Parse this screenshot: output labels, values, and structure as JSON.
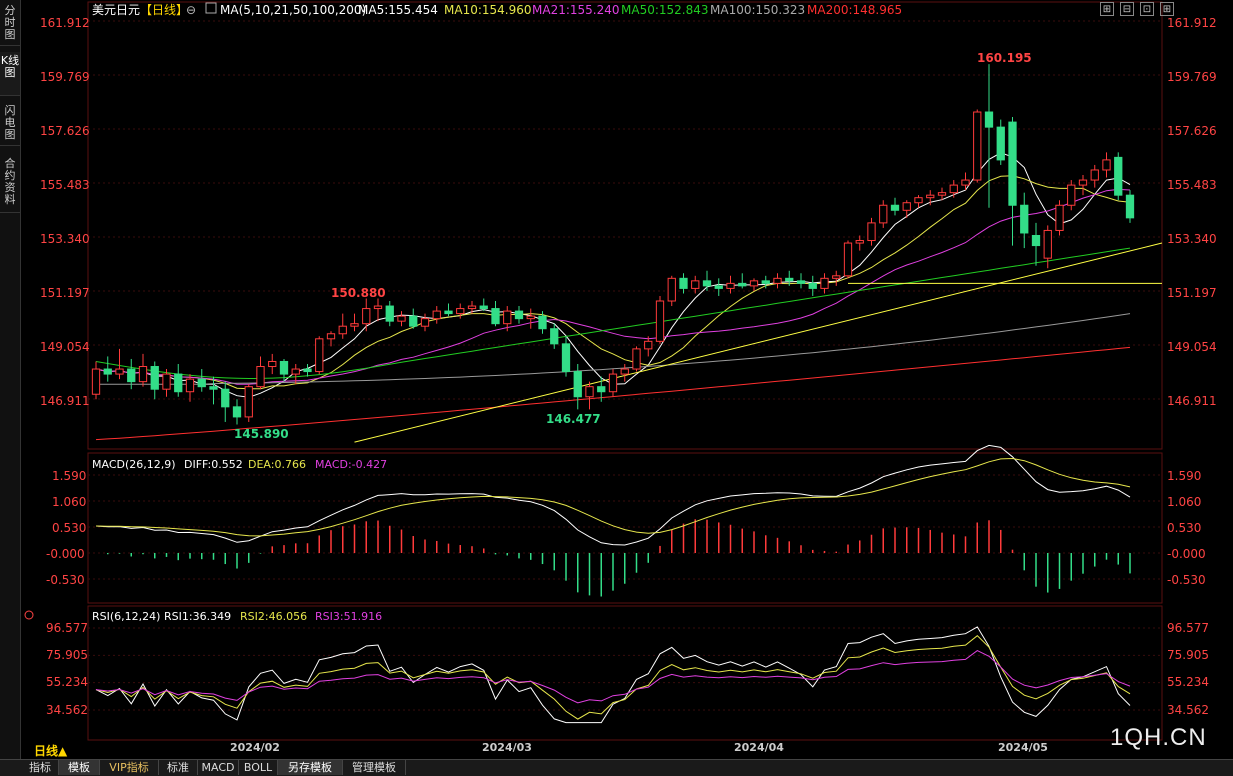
{
  "sidebar": {
    "tabs": [
      {
        "label": "分时图",
        "active": false
      },
      {
        "label": "K线图",
        "active": true
      },
      {
        "label": "闪电图",
        "active": false
      },
      {
        "label": "合约资料",
        "active": false
      }
    ]
  },
  "header": {
    "symbol": "美元日元",
    "period_tag": "【日线】",
    "ma_title": "MA(5,10,21,50,100,200)",
    "ma5": "MA5:155.454",
    "ma10": "MA10:154.960",
    "ma21": "MA21:155.240",
    "ma50": "MA50:152.843",
    "ma100": "MA100:150.323",
    "ma200": "MA200:148.965"
  },
  "price_axis": [
    "161.912",
    "159.769",
    "157.626",
    "155.483",
    "153.340",
    "151.197",
    "149.054",
    "146.911"
  ],
  "annotations": {
    "high": "160.195",
    "low1": "145.890",
    "low2": "146.477",
    "mid_high": "150.880"
  },
  "macd": {
    "title": "MACD(26,12,9)",
    "diff": "DIFF:0.552",
    "dea": "DEA:0.766",
    "macd": "MACD:-0.427",
    "axis": [
      "1.590",
      "1.060",
      "0.530",
      "-0.000",
      "-0.530"
    ]
  },
  "rsi": {
    "title": "RSI(6,12,24)",
    "rsi1": "RSI1:36.349",
    "rsi2": "RSI2:46.056",
    "rsi3": "RSI3:51.916",
    "axis": [
      "96.577",
      "75.905",
      "55.234",
      "34.562"
    ]
  },
  "date_axis": [
    "2024/02",
    "2024/03",
    "2024/04",
    "2024/05"
  ],
  "bottom_tabs": [
    {
      "label": "指标",
      "active": false
    },
    {
      "label": "模板",
      "active": true
    },
    {
      "label": "VIP指标",
      "active": false
    },
    {
      "label": "标准",
      "active": false
    },
    {
      "label": "MACD",
      "active": false
    },
    {
      "label": "BOLL",
      "active": false
    },
    {
      "label": "另存模板",
      "active": true
    },
    {
      "label": "管理模板",
      "active": false
    }
  ],
  "period_label": "日线▲",
  "watermark": "1QH.CN",
  "colors": {
    "up": "#ff3b3b",
    "down": "#33dd88",
    "ma5": "#ffffff",
    "ma10": "#e6e64c",
    "ma21": "#e040e0",
    "ma50": "#22cc22",
    "ma100": "#999999",
    "ma200": "#ff3030",
    "trend": "#ffff44",
    "axis_text": "#ff4444"
  },
  "chart_data": {
    "type": "candlestick",
    "title": "美元日元【日线】",
    "x_labels": [
      "2024/02",
      "2024/03",
      "2024/04",
      "2024/05"
    ],
    "ylim": [
      145.5,
      162.3
    ],
    "y_ticks": [
      161.912,
      159.769,
      157.626,
      155.483,
      153.34,
      151.197,
      149.054,
      146.911
    ],
    "ohlc": [
      [
        147.1,
        148.4,
        146.9,
        148.1
      ],
      [
        148.1,
        148.6,
        147.6,
        147.9
      ],
      [
        147.9,
        148.9,
        147.7,
        148.1
      ],
      [
        148.1,
        148.5,
        147.3,
        147.6
      ],
      [
        147.6,
        148.7,
        147.4,
        148.2
      ],
      [
        148.2,
        148.4,
        146.9,
        147.3
      ],
      [
        147.3,
        148.1,
        147.0,
        147.9
      ],
      [
        147.9,
        148.3,
        147.0,
        147.2
      ],
      [
        147.2,
        147.9,
        146.8,
        147.7
      ],
      [
        147.7,
        148.1,
        147.2,
        147.4
      ],
      [
        147.4,
        147.8,
        146.7,
        147.3
      ],
      [
        147.3,
        147.6,
        146.0,
        146.6
      ],
      [
        146.6,
        146.9,
        145.9,
        146.2
      ],
      [
        146.2,
        147.5,
        146.0,
        147.4
      ],
      [
        147.4,
        148.6,
        147.3,
        148.2
      ],
      [
        148.2,
        148.7,
        147.9,
        148.4
      ],
      [
        148.4,
        148.5,
        147.6,
        147.9
      ],
      [
        147.9,
        148.3,
        147.5,
        148.1
      ],
      [
        148.1,
        148.3,
        147.8,
        148.0
      ],
      [
        148.0,
        149.4,
        147.9,
        149.3
      ],
      [
        149.3,
        149.6,
        149.0,
        149.5
      ],
      [
        149.5,
        150.3,
        149.3,
        149.8
      ],
      [
        149.8,
        150.3,
        149.6,
        149.9
      ],
      [
        149.9,
        150.9,
        149.6,
        150.5
      ],
      [
        150.5,
        150.9,
        150.0,
        150.6
      ],
      [
        150.6,
        150.8,
        149.8,
        150.0
      ],
      [
        150.0,
        150.4,
        149.8,
        150.2
      ],
      [
        150.2,
        150.5,
        149.7,
        149.8
      ],
      [
        149.8,
        150.3,
        149.6,
        150.1
      ],
      [
        150.1,
        150.6,
        149.9,
        150.4
      ],
      [
        150.4,
        150.7,
        150.2,
        150.3
      ],
      [
        150.3,
        150.7,
        150.1,
        150.5
      ],
      [
        150.5,
        150.8,
        150.3,
        150.6
      ],
      [
        150.6,
        150.9,
        150.4,
        150.5
      ],
      [
        150.5,
        150.8,
        149.8,
        149.9
      ],
      [
        149.9,
        150.6,
        149.6,
        150.4
      ],
      [
        150.4,
        150.6,
        149.9,
        150.1
      ],
      [
        150.1,
        150.5,
        149.7,
        150.2
      ],
      [
        150.2,
        150.4,
        149.5,
        149.7
      ],
      [
        149.7,
        149.9,
        148.9,
        149.1
      ],
      [
        149.1,
        149.4,
        147.8,
        148.0
      ],
      [
        148.0,
        148.3,
        146.5,
        147.0
      ],
      [
        147.0,
        147.6,
        146.5,
        147.4
      ],
      [
        147.4,
        147.8,
        146.8,
        147.2
      ],
      [
        147.2,
        148.1,
        147.0,
        147.9
      ],
      [
        147.9,
        148.3,
        147.6,
        148.1
      ],
      [
        148.1,
        149.0,
        148.0,
        148.9
      ],
      [
        148.9,
        149.4,
        148.6,
        149.2
      ],
      [
        149.2,
        151.0,
        149.1,
        150.8
      ],
      [
        150.8,
        151.8,
        150.6,
        151.7
      ],
      [
        151.7,
        151.9,
        151.1,
        151.3
      ],
      [
        151.3,
        151.8,
        151.1,
        151.6
      ],
      [
        151.6,
        152.0,
        151.2,
        151.4
      ],
      [
        151.4,
        151.7,
        151.0,
        151.3
      ],
      [
        151.3,
        151.8,
        151.1,
        151.5
      ],
      [
        151.5,
        151.9,
        151.3,
        151.4
      ],
      [
        151.4,
        151.7,
        151.2,
        151.6
      ],
      [
        151.6,
        151.8,
        151.3,
        151.5
      ],
      [
        151.5,
        151.9,
        151.3,
        151.7
      ],
      [
        151.7,
        152.0,
        151.4,
        151.6
      ],
      [
        151.6,
        151.9,
        151.3,
        151.5
      ],
      [
        151.5,
        151.8,
        151.0,
        151.3
      ],
      [
        151.3,
        151.9,
        151.1,
        151.7
      ],
      [
        151.7,
        152.0,
        151.4,
        151.8
      ],
      [
        151.8,
        153.2,
        151.7,
        153.1
      ],
      [
        153.1,
        153.4,
        152.8,
        153.2
      ],
      [
        153.2,
        154.1,
        153.0,
        153.9
      ],
      [
        153.9,
        154.8,
        153.7,
        154.6
      ],
      [
        154.6,
        154.9,
        154.2,
        154.4
      ],
      [
        154.4,
        154.8,
        154.1,
        154.7
      ],
      [
        154.7,
        155.0,
        154.5,
        154.9
      ],
      [
        154.9,
        155.2,
        154.6,
        155.0
      ],
      [
        155.0,
        155.3,
        154.8,
        155.1
      ],
      [
        155.1,
        155.6,
        154.9,
        155.4
      ],
      [
        155.4,
        155.9,
        155.2,
        155.6
      ],
      [
        155.6,
        158.4,
        155.5,
        158.3
      ],
      [
        158.3,
        160.2,
        154.5,
        157.7
      ],
      [
        157.7,
        158.0,
        156.2,
        156.4
      ],
      [
        157.9,
        158.1,
        153.0,
        154.6
      ],
      [
        154.6,
        155.1,
        152.9,
        153.5
      ],
      [
        153.4,
        153.9,
        152.2,
        153.0
      ],
      [
        152.5,
        153.8,
        152.1,
        153.6
      ],
      [
        153.6,
        154.8,
        153.4,
        154.6
      ],
      [
        154.6,
        155.6,
        154.4,
        155.4
      ],
      [
        155.4,
        155.8,
        155.0,
        155.6
      ],
      [
        155.6,
        156.2,
        155.3,
        156.0
      ],
      [
        156.0,
        156.7,
        155.7,
        156.4
      ],
      [
        156.5,
        156.7,
        154.8,
        155.0
      ],
      [
        155.0,
        155.2,
        153.9,
        154.1
      ]
    ],
    "macd_levels": {
      "DIFF": 0.552,
      "DEA": 0.766,
      "MACD": -0.427
    },
    "rsi_levels": {
      "RSI1": 36.349,
      "RSI2": 46.056,
      "RSI3": 51.916
    },
    "macd_ylim": [
      -0.9,
      1.7
    ],
    "rsi_ylim": [
      20,
      100
    ]
  }
}
